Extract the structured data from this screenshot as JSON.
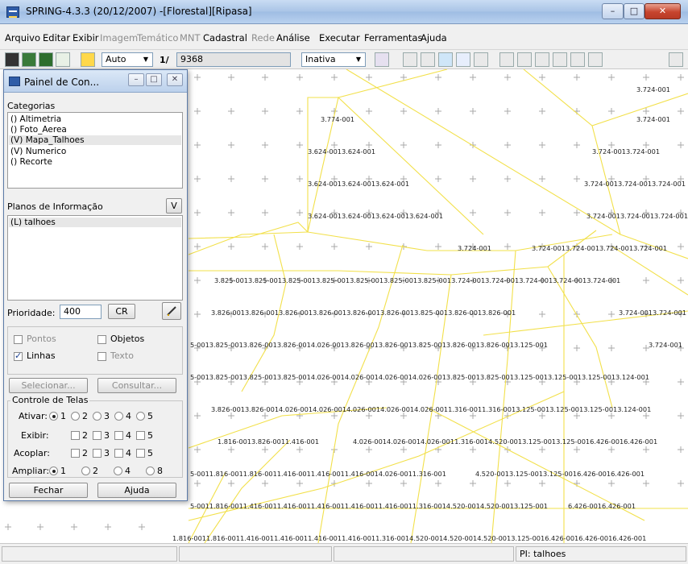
{
  "window": {
    "title": "SPRING-4.3.3 (20/12/2007) -[Florestal][Ripasa]",
    "min_glyph": "–",
    "max_glyph": "□",
    "close_glyph": "✕"
  },
  "menu": [
    {
      "label": "Arquivo",
      "enabled": true
    },
    {
      "label": "Editar",
      "enabled": true
    },
    {
      "label": "Exibir",
      "enabled": true
    },
    {
      "label": "Imagem",
      "enabled": false
    },
    {
      "label": "Temático",
      "enabled": false
    },
    {
      "label": "MNT",
      "enabled": false
    },
    {
      "label": "Cadastral",
      "enabled": true
    },
    {
      "label": "Rede",
      "enabled": false
    },
    {
      "label": "Análise",
      "enabled": true
    },
    {
      "label": "Executar",
      "enabled": true
    },
    {
      "label": "Ferramentas",
      "enabled": true
    },
    {
      "label": "Ajuda",
      "enabled": true
    }
  ],
  "toolbar": {
    "zoom_mode": "Auto",
    "scale_prefix": "1/",
    "scale_value": "9368",
    "inactive_select": "Inativa",
    "dropdown_glyph": "▼"
  },
  "panel": {
    "title": "Painel de Con...",
    "min_glyph": "–",
    "restore_glyph": "□",
    "close_glyph": "✕",
    "categories_label": "Categorias",
    "categories": [
      {
        "label": "() Altimetria",
        "selected": false
      },
      {
        "label": "() Foto_Aerea",
        "selected": false
      },
      {
        "label": "(V) Mapa_Talhoes",
        "selected": true
      },
      {
        "label": "(V) Numerico",
        "selected": false
      },
      {
        "label": "() Recorte",
        "selected": false
      }
    ],
    "planes_label": "Planos de Informação",
    "planes_btn": "V",
    "planes": [
      {
        "label": "(L) talhoes",
        "selected": true
      }
    ],
    "priority_label": "Prioridade:",
    "priority_value": "400",
    "cr_label": "CR",
    "options": {
      "pontos": {
        "label": "Pontos",
        "checked": false
      },
      "objetos": {
        "label": "Objetos",
        "checked": false
      },
      "linhas": {
        "label": "Linhas",
        "checked": true
      },
      "texto": {
        "label": "Texto",
        "checked": false
      }
    },
    "select_btn": "Selecionar...",
    "query_btn": "Consultar...",
    "screens_group": "Controle de Telas",
    "row_ativar": "Ativar:",
    "row_exibir": "Exibir:",
    "row_acoplar": "Acoplar:",
    "row_ampliar": "Ampliar:",
    "screen_nums": [
      "1",
      "2",
      "3",
      "4",
      "5"
    ],
    "zoom_nums": [
      "1",
      "2",
      "4",
      "8"
    ],
    "close_btn": "Fechar",
    "help_btn": "Ajuda"
  },
  "map": {
    "line_color": "#f2e04a",
    "cross_color": "#a8a8a8",
    "label_color": "#222222",
    "labels": [
      "3.724-001",
      "3.724-001",
      "3.774-001",
      "3.624-0013.624-001",
      "3.724-0013.724-001",
      "3.624-0013.624-0013.624-001",
      "3.724-0013.724-0013.724-001",
      "3.624-0013.624-0013.624-0013.624-001",
      "3.724-0013.724-0013.724-001",
      "3.724-001",
      "3.724-0013.724-0013.724-0013.724-001",
      "3.825-0013.825-0013.825-0013.825-0013.825-0013.825-0013.825-0013.724-0013.724-0013.724-0013.724-0013.724-001",
      "3.826-0013.826-0013.826-0013.826-0013.826-0013.826-0013.825-0013.826-0013.826-001",
      "3.724-0013.724-001",
      "5-0013.825-0013.826-0013.826-0014.026-0013.826-0013.826-0013.825-0013.826-0013.826-0013.125-001",
      "3.724-001",
      "5-0013.825-0013.825-0013.825-0014.026-0014.026-0014.026-0014.026-0013.825-0013.825-0013.125-0013.125-0013.125-0013.124-001",
      "3.826-0013.826-0014.026-0014.026-0014.026-0014.026-0014.026-0011.316-0011.316-0013.125-0013.125-0013.125-0013.124-001",
      "1.816-0013.826-0011.416-001",
      "4.026-0014.026-0014.026-0011.316-0014.520-0013.125-0013.125-0016.426-0016.426-001",
      "5-0011.816-0011.816-0011.416-0011.416-0011.416-0014.026-0011.316-001",
      "4.520-0013.125-0013.125-0016.426-0016.426-001",
      "5-0011.816-0011.416-0011.416-0011.416-0011.416-0011.416-0011.316-0014.520-0014.520-0013.125-001",
      "6.426-0016.426-001",
      "1.816-0011.816-0011.416-0011.416-0011.416-0011.416-0011.316-0014.520-0014.520-0014.520-0013.125-0016.426-0016.426-0016.426-001"
    ]
  },
  "status": {
    "plane": "PI: talhoes"
  }
}
